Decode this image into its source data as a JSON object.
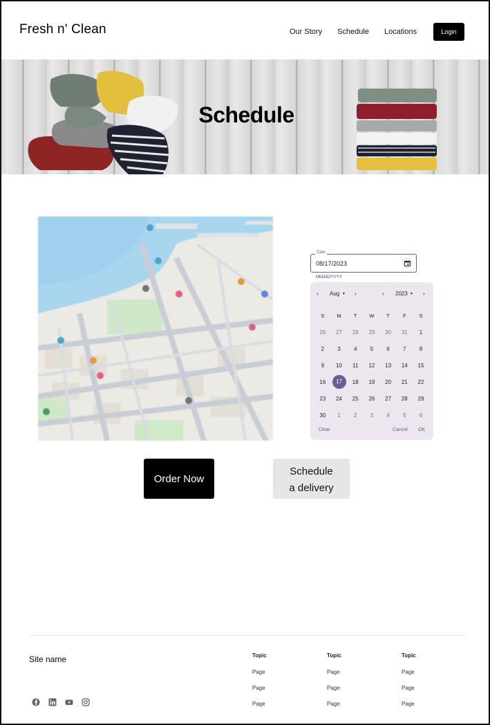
{
  "header": {
    "brand": "Fresh n' Clean",
    "nav": [
      "Our Story",
      "Schedule",
      "Locations"
    ],
    "login_label": "Login"
  },
  "hero": {
    "title": "Schedule"
  },
  "date_picker": {
    "label": "Date",
    "value": "08/17/2023",
    "helper": "MM/DD/YYYY",
    "month": "Aug",
    "year": "2023",
    "weekdays": [
      "S",
      "M",
      "T",
      "W",
      "T",
      "F",
      "S"
    ],
    "weeks": [
      [
        "26",
        "27",
        "28",
        "29",
        "30",
        "31",
        "1"
      ],
      [
        "2",
        "3",
        "4",
        "5",
        "6",
        "7",
        "8"
      ],
      [
        "9",
        "10",
        "11",
        "12",
        "13",
        "14",
        "15"
      ],
      [
        "16",
        "17",
        "18",
        "19",
        "20",
        "21",
        "22"
      ],
      [
        "23",
        "24",
        "25",
        "26",
        "27",
        "28",
        "29"
      ],
      [
        "30",
        "1",
        "2",
        "3",
        "4",
        "5",
        "6"
      ]
    ],
    "selected_day": "17",
    "clear_label": "Clear",
    "cancel_label": "Cancel",
    "ok_label": "OK"
  },
  "actions": {
    "order_label": "Order Now",
    "schedule_line1": "Schedule",
    "schedule_line2": "a delivery"
  },
  "footer": {
    "site_name": "Site name",
    "columns": [
      {
        "topic": "Topic",
        "pages": [
          "Page",
          "Page",
          "Page"
        ]
      },
      {
        "topic": "Topic",
        "pages": [
          "Page",
          "Page",
          "Page"
        ]
      },
      {
        "topic": "Topic",
        "pages": [
          "Page",
          "Page",
          "Page"
        ]
      }
    ],
    "social_icons": [
      "facebook-icon",
      "linkedin-icon",
      "youtube-icon",
      "instagram-icon"
    ]
  },
  "colors": {
    "accent": "#6b5c96",
    "calendar_bg": "#ece7ee",
    "button_dark": "#000000",
    "button_light": "#e6e6e6"
  }
}
